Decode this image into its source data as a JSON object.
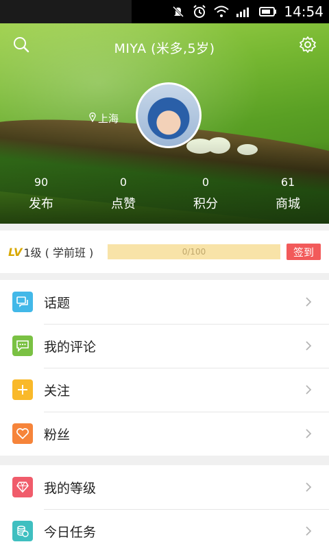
{
  "status_bar": {
    "time": "14:54"
  },
  "profile": {
    "title": "MIYA (米多,5岁)",
    "location": "上海",
    "stats": [
      {
        "value": "90",
        "label": "发布"
      },
      {
        "value": "0",
        "label": "点赞"
      },
      {
        "value": "0",
        "label": "积分"
      },
      {
        "value": "61",
        "label": "商城"
      }
    ]
  },
  "level": {
    "badge": "LV",
    "text": "1级 ( 学前班 )",
    "progress_text": "0/100",
    "progress_fraction": 0,
    "signin_label": "签到"
  },
  "menu_group_1": [
    {
      "label": "话题",
      "icon": "chat-bubble-icon",
      "color": "#42b8e8"
    },
    {
      "label": "我的评论",
      "icon": "comment-icon",
      "color": "#7ac143"
    },
    {
      "label": "关注",
      "icon": "plus-icon",
      "color": "#f9b92a"
    },
    {
      "label": "粉丝",
      "icon": "heart-icon",
      "color": "#f6843a"
    }
  ],
  "menu_group_2": [
    {
      "label": "我的等级",
      "icon": "diamond-icon",
      "color": "#f05c6b"
    },
    {
      "label": "今日任务",
      "icon": "coins-icon",
      "color": "#3fbfc0"
    }
  ]
}
